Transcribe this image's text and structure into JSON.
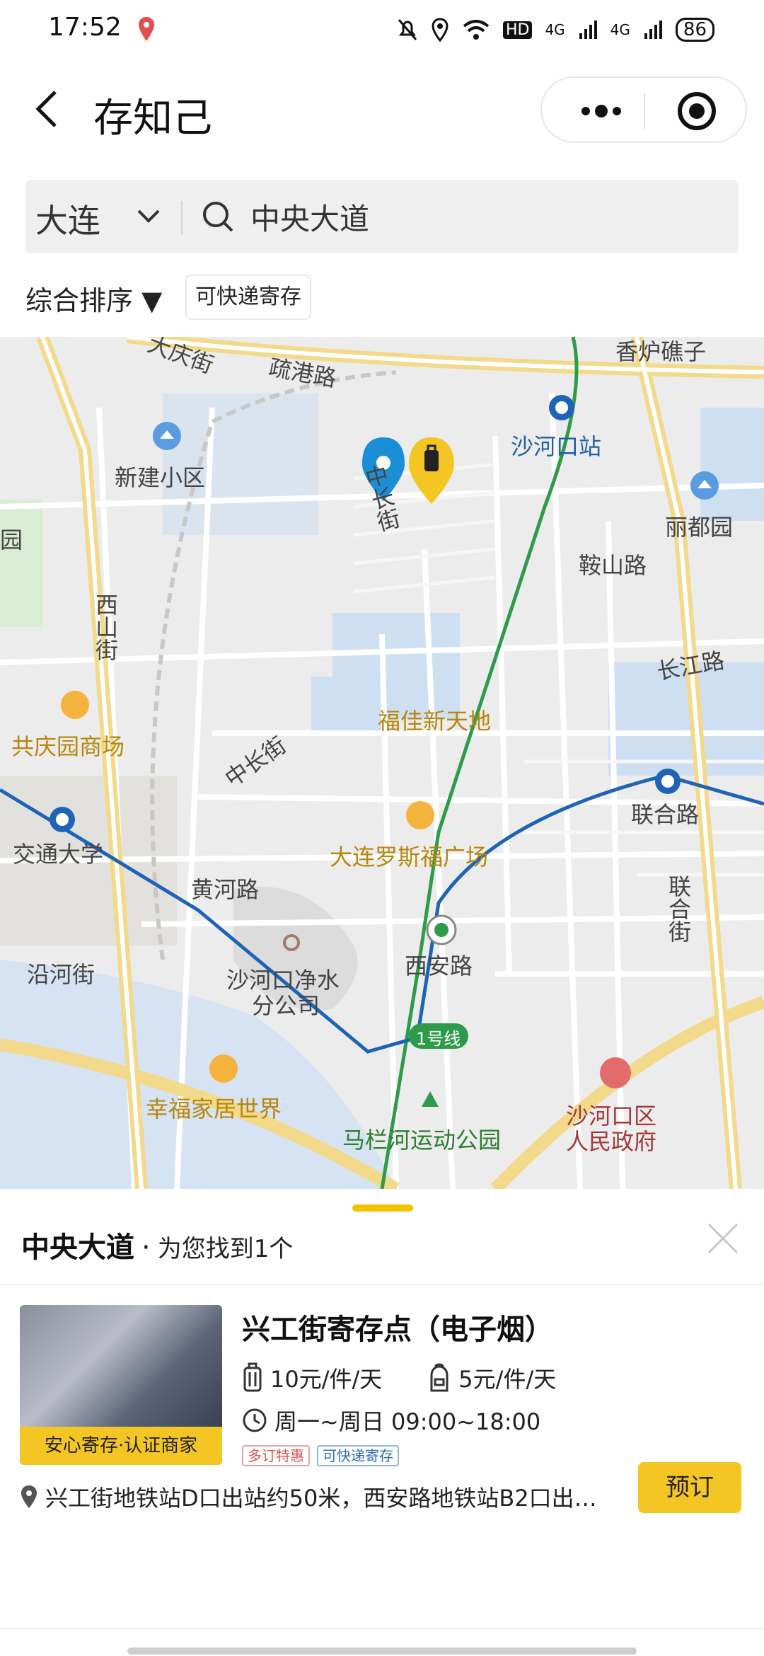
{
  "status_bar": {
    "time": "17:52",
    "battery": "86",
    "network_1": "4G",
    "network_2": "4G",
    "hd": "HD"
  },
  "header": {
    "title": "存知己"
  },
  "search": {
    "city": "大连",
    "query": "中央大道"
  },
  "filters": {
    "sort_label": "综合排序 ▼",
    "chip_label": "可快递寄存"
  },
  "map": {
    "labels": {
      "road_shugang": "疏港路",
      "road_daqing": "大庆街",
      "road_xiangluojiao": "香炉礁子",
      "metro_shahekou": "沙河口站",
      "area_xinjian": "新建小区",
      "area_lidu": "丽都园",
      "road_zhongchang_v": "中长街",
      "road_anshan": "鞍山路",
      "road_xishan": "西山街",
      "road_changjiang": "长江路",
      "poi_gongqingyuan": "共庆园商场",
      "poi_fujia": "福佳新天地",
      "road_zhongchang": "中长街",
      "metro_lianhe": "联合路",
      "metro_jiaotong": "交通大学",
      "poi_luosifu": "大连罗斯福广场",
      "road_huanghe": "黄河路",
      "road_lianhe_v": "联合街",
      "road_yanhe": "沿河街",
      "poi_water_1": "沙河口净水",
      "poi_water_2": "分公司",
      "metro_xian": "西安路",
      "line_badge": "1号线",
      "poi_xingfu": "幸福家居世界",
      "park_malan": "马栏河运动公园",
      "gov_1": "沙河口区",
      "gov_2": "人民政府",
      "area_yuan": "园"
    }
  },
  "results": {
    "keyword": "中央大道",
    "dot": "·",
    "count_text": "为您找到1个",
    "items": [
      {
        "name": "兴工街寄存点（电子烟）",
        "badge": "安心寄存·认证商家",
        "price_large": "10元/件/天",
        "price_small": "5元/件/天",
        "hours": "周一~周日 09:00~18:00",
        "tags": [
          "多订特惠",
          "可快递寄存"
        ],
        "address": "兴工街地铁站D口出站约50米，西安路地铁站B2口出…",
        "book_label": "预订"
      }
    ]
  }
}
